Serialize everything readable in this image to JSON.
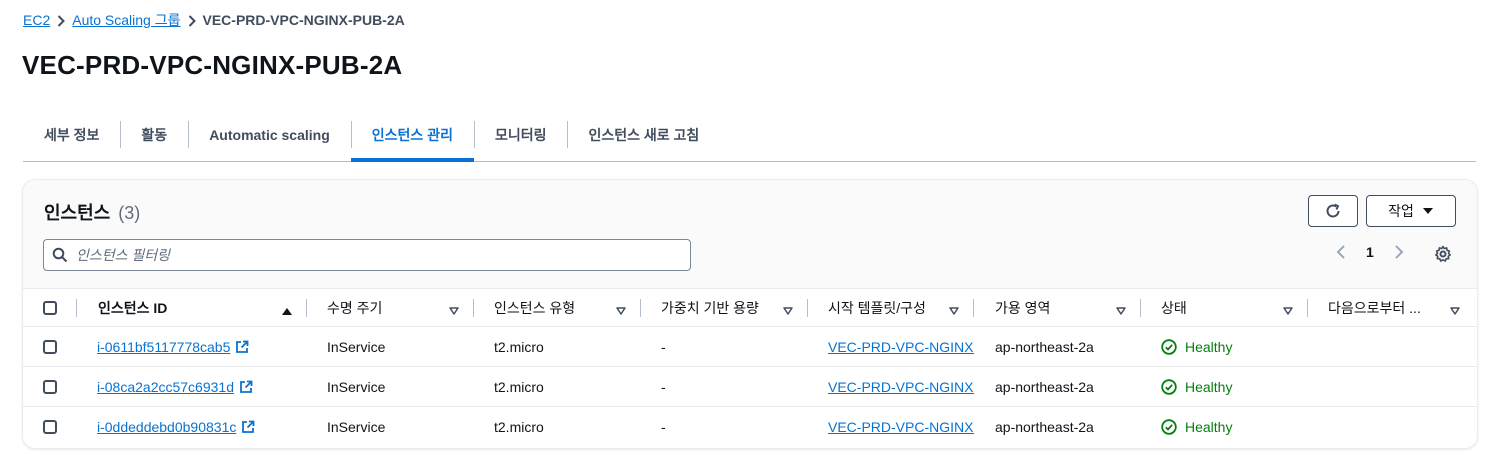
{
  "breadcrumb": {
    "items": [
      "EC2",
      "Auto Scaling 그룹"
    ],
    "current": "VEC-PRD-VPC-NGINX-PUB-2A"
  },
  "page_title": "VEC-PRD-VPC-NGINX-PUB-2A",
  "tabs": [
    {
      "label": "세부 정보",
      "active": false
    },
    {
      "label": "활동",
      "active": false
    },
    {
      "label": "Automatic scaling",
      "active": false
    },
    {
      "label": "인스턴스 관리",
      "active": true
    },
    {
      "label": "모니터링",
      "active": false
    },
    {
      "label": "인스턴스 새로 고침",
      "active": false
    }
  ],
  "panel": {
    "title": "인스턴스",
    "count": "(3)",
    "action_label": "작업",
    "search_placeholder": "인스턴스 필터링",
    "page_number": "1"
  },
  "columns": [
    "인스턴스 ID",
    "수명 주기",
    "인스턴스 유형",
    "가중치 기반 용량",
    "시작 템플릿/구성",
    "가용 영역",
    "상태",
    "다음으로부터 ..."
  ],
  "rows": [
    {
      "id": "i-0611bf5117778cab5",
      "lifecycle": "InService",
      "type": "t2.micro",
      "weight": "-",
      "template": "VEC-PRD-VPC-NGINX-F",
      "az": "ap-northeast-2a",
      "status": "Healthy"
    },
    {
      "id": "i-08ca2a2cc57c6931d",
      "lifecycle": "InService",
      "type": "t2.micro",
      "weight": "-",
      "template": "VEC-PRD-VPC-NGINX-F",
      "az": "ap-northeast-2a",
      "status": "Healthy"
    },
    {
      "id": "i-0ddeddebd0b90831c",
      "lifecycle": "InService",
      "type": "t2.micro",
      "weight": "-",
      "template": "VEC-PRD-VPC-NGINX-F",
      "az": "ap-northeast-2a",
      "status": "Healthy"
    }
  ],
  "colors": {
    "link": "#0972d3",
    "healthy": "#037f0c",
    "text": "#0f141a"
  },
  "icons": [
    "chevron-right-icon",
    "refresh-icon",
    "caret-down-icon",
    "search-icon",
    "chevron-left-icon",
    "settings-gear-icon",
    "sort-ascending-icon",
    "sort-icon",
    "external-link-icon",
    "check-circle-icon"
  ]
}
